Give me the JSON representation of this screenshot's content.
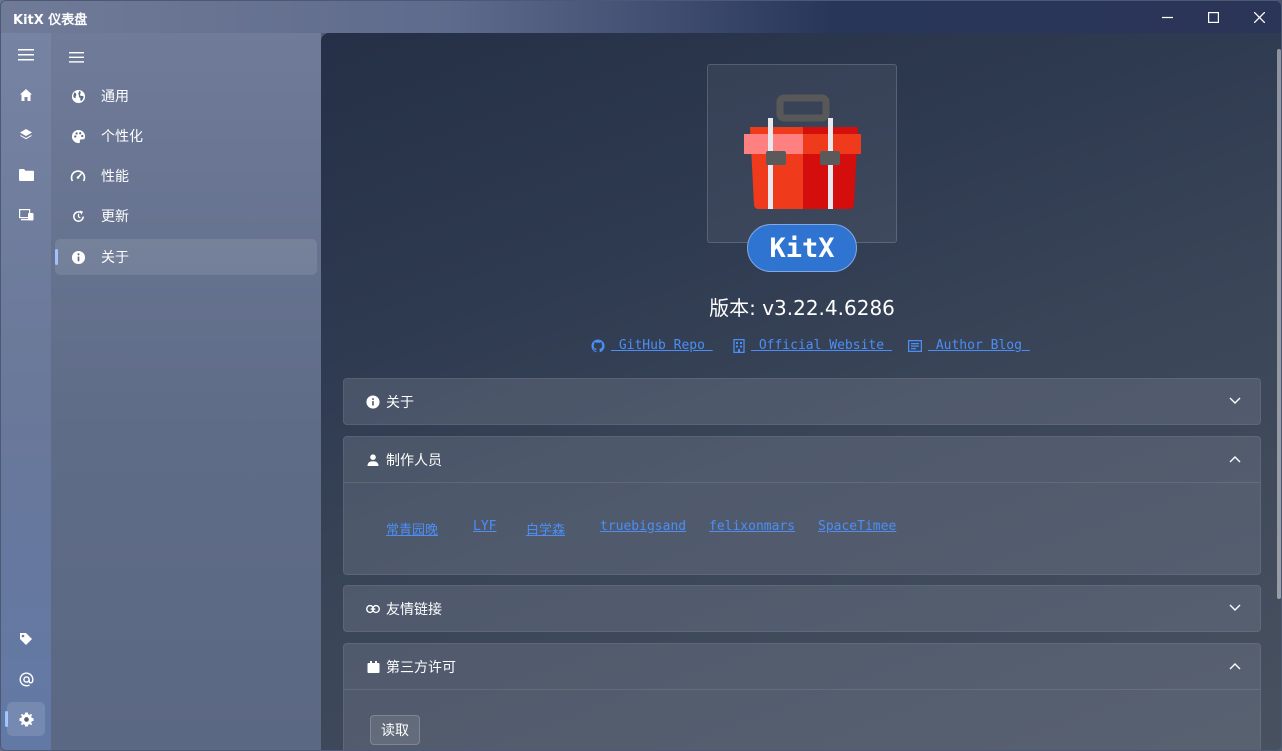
{
  "window": {
    "title": "KitX 仪表盘",
    "controls": [
      "minimize",
      "maximize",
      "close"
    ]
  },
  "rail": {
    "top_items": [
      {
        "name": "menu",
        "icon": "hamburger-icon"
      },
      {
        "name": "home",
        "icon": "home-icon"
      },
      {
        "name": "plugins",
        "icon": "layers-icon"
      },
      {
        "name": "repo",
        "icon": "folder-icon"
      },
      {
        "name": "devices",
        "icon": "devices-icon"
      }
    ],
    "bottom_items": [
      {
        "name": "tags",
        "icon": "tag-icon"
      },
      {
        "name": "account",
        "icon": "at-icon"
      },
      {
        "name": "settings",
        "icon": "gear-icon",
        "active": true
      }
    ]
  },
  "settings_nav": {
    "items": [
      {
        "label": "通用",
        "icon": "globe-icon"
      },
      {
        "label": "个性化",
        "icon": "palette-icon"
      },
      {
        "label": "性能",
        "icon": "speedometer-icon"
      },
      {
        "label": "更新",
        "icon": "refresh-icon"
      },
      {
        "label": "关于",
        "icon": "info-icon",
        "active": true
      }
    ]
  },
  "about": {
    "badge": "KitX",
    "version": "版本: v3.22.4.6286",
    "links": [
      {
        "label": " GitHub Repo ",
        "icon": "github-icon"
      },
      {
        "label": " Official Website ",
        "icon": "building-icon"
      },
      {
        "label": " Author Blog ",
        "icon": "blog-icon"
      }
    ],
    "sections": [
      {
        "label": "关于",
        "icon": "info-icon",
        "expanded": false
      },
      {
        "label": "制作人员",
        "icon": "person-icon",
        "expanded": true,
        "credits": [
          "常青园晚",
          "LYF",
          "白学森",
          "truebigsand",
          "felixonmars",
          "SpaceTimee"
        ]
      },
      {
        "label": "友情链接",
        "icon": "link-icon",
        "expanded": false
      },
      {
        "label": "第三方许可",
        "icon": "license-icon",
        "expanded": true,
        "button": "读取"
      }
    ]
  },
  "colors": {
    "link": "#4c8ef5",
    "badge": "#2f74d0",
    "accent_indicator": "#9fc3ff"
  }
}
